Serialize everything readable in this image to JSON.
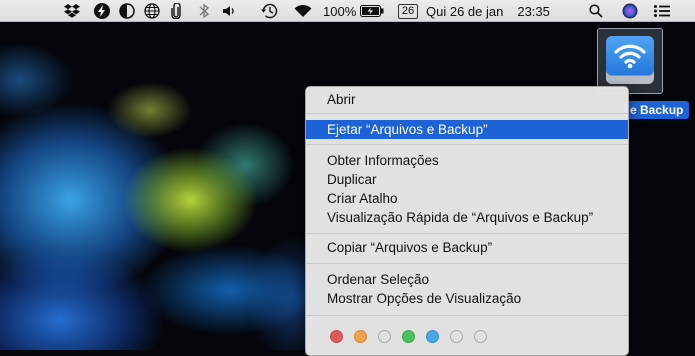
{
  "menubar": {
    "icons": [
      "dropbox-icon",
      "flash-icon",
      "contrast-icon",
      "globe-icon",
      "paperclip-icon",
      "bluetooth-icon",
      "volume-icon",
      "time-machine-icon",
      "wifi-icon"
    ],
    "battery_percent": "100%",
    "calendar_badge": "26",
    "datetime": "Qui 26 de jan",
    "time": "23:35",
    "right_icons": [
      "spotlight-icon",
      "siri-icon",
      "notification-center-icon"
    ]
  },
  "desktop": {
    "drive_label_visible": "e Backup"
  },
  "context_menu": {
    "items": [
      {
        "label": "Abrir"
      },
      {
        "label": "Ejetar “Arquivos e Backup”",
        "selected": true
      },
      {
        "label": "Obter Informações"
      },
      {
        "label": "Duplicar"
      },
      {
        "label": "Criar Atalho"
      },
      {
        "label": "Visualização Rápida de “Arquivos e Backup”"
      },
      {
        "label": "Copiar “Arquivos e Backup”"
      },
      {
        "label": "Ordenar Seleção"
      },
      {
        "label": "Mostrar Opções de Visualização"
      }
    ],
    "tag_colors": [
      "#e05b5b",
      "#f0a34a",
      "#cfcfcf",
      "#4cc05c",
      "#4aa8e8",
      "#cfcfcf",
      "#cfcfcf"
    ]
  }
}
